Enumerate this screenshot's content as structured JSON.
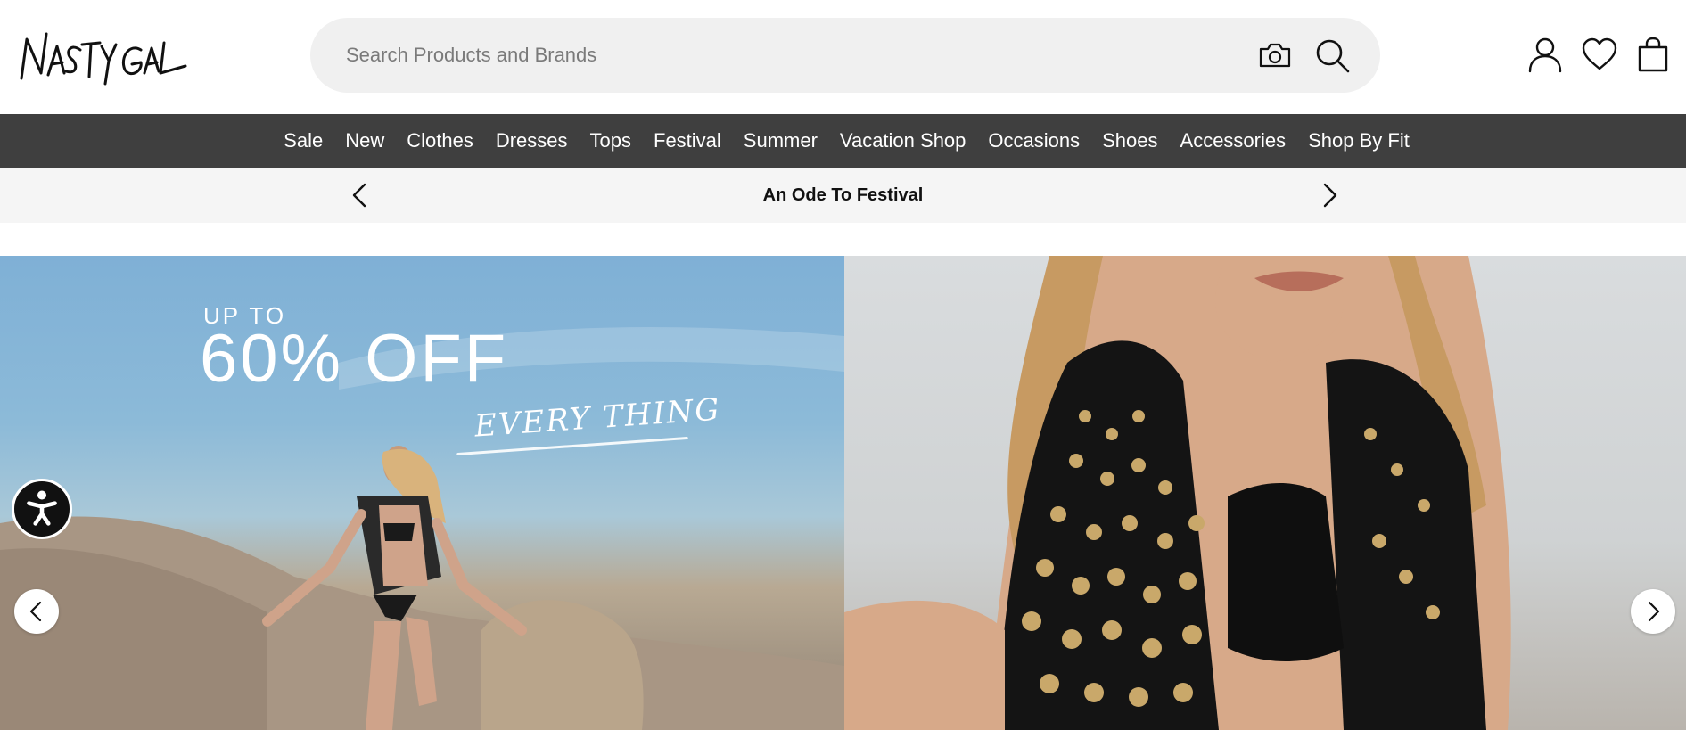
{
  "brand": {
    "logo_text": "NASTY GAL"
  },
  "search": {
    "placeholder": "Search Products and Brands",
    "value": ""
  },
  "header_icons": [
    "account-icon",
    "wishlist-heart-icon",
    "shopping-bag-icon"
  ],
  "nav": {
    "items": [
      {
        "label": "Sale"
      },
      {
        "label": "New"
      },
      {
        "label": "Clothes"
      },
      {
        "label": "Dresses"
      },
      {
        "label": "Tops"
      },
      {
        "label": "Festival"
      },
      {
        "label": "Summer"
      },
      {
        "label": "Vacation Shop"
      },
      {
        "label": "Occasions"
      },
      {
        "label": "Shoes"
      },
      {
        "label": "Accessories"
      },
      {
        "label": "Shop By Fit"
      }
    ]
  },
  "promo_banner": {
    "text": "An Ode To Festival"
  },
  "hero": {
    "offer_prefix": "UP TO",
    "offer_main": "60% OFF",
    "offer_sub": "EVERY THING"
  },
  "colors": {
    "nav_background": "#3f3f3f",
    "search_background": "#f0f0f0",
    "promo_background": "#f5f5f5",
    "accessibility_button": "#111111"
  }
}
